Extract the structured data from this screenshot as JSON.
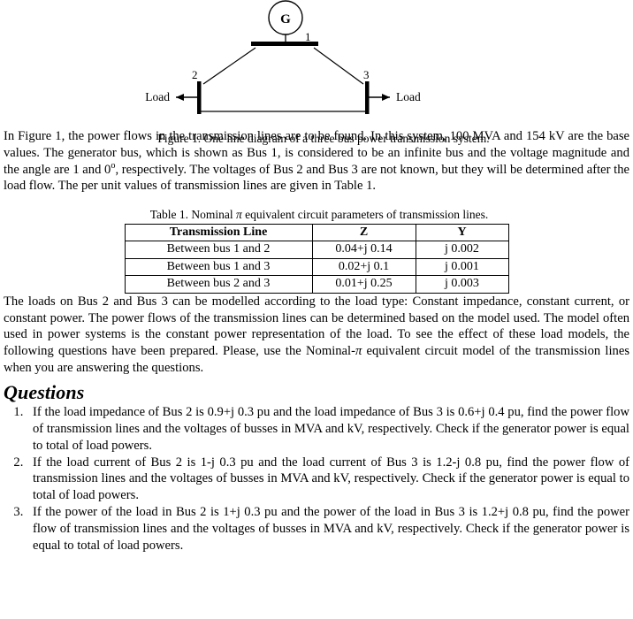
{
  "figure": {
    "generator_label": "G",
    "bus1_label": "1",
    "bus2_label": "2",
    "bus3_label": "3",
    "load_left_label": "Load",
    "load_right_label": "Load",
    "caption": "Figure 1. One line diagram of a three bus power transmission system."
  },
  "paragraphs": {
    "intro_part1": "In Figure 1, the power flows in the transmission lines are to be found. In this system, 100 MVA and 154 kV are the base values. The generator bus, which is shown as Bus 1, is considered to be an infinite bus and the voltage magnitude and the angle are 1 and 0",
    "intro_degree": "o",
    "intro_part2": ", respectively. The voltages of Bus 2 and Bus 3 are not known, but they will be determined after the load flow. The per unit values of transmission lines are given in Table 1.",
    "loads_part1": "The loads on Bus 2 and Bus 3 can be modelled according to the load type: Constant impedance, constant current, or constant power. The power flows of the transmission lines can be determined based on the model used. The model often used in power systems is the constant power representation of the load. To see the effect of these load models, the following questions have been prepared. Please, use the Nominal-",
    "loads_pi": "π",
    "loads_part2": " equivalent circuit model of the transmission lines when you are answering the questions."
  },
  "table": {
    "caption_part1": "Table 1. Nominal ",
    "caption_pi": "π",
    "caption_part2": " equivalent circuit parameters of transmission lines.",
    "headers": [
      "Transmission Line",
      "Z",
      "Y"
    ],
    "rows": [
      {
        "line": "Between bus 1 and 2",
        "z": "0.04+j 0.14",
        "y": "j 0.002"
      },
      {
        "line": "Between bus 1 and 3",
        "z": "0.02+j 0.1",
        "y": "j 0.001"
      },
      {
        "line": "Between bus 2 and 3",
        "z": "0.01+j 0.25",
        "y": "j 0.003"
      }
    ]
  },
  "questions": {
    "heading": "Questions",
    "items": [
      "If the load impedance of Bus 2 is 0.9+j 0.3 pu and the load impedance of Bus 3 is 0.6+j 0.4 pu, find the power flow of transmission lines and the voltages of busses in MVA and kV, respectively. Check if the generator power is equal to total of load powers.",
      "If the load current of Bus 2 is 1-j 0.3 pu and the load current of Bus 3 is 1.2-j 0.8 pu, find the power flow of transmission lines and the voltages of busses in MVA and kV, respectively. Check if the generator power is equal to total of load powers.",
      "If the power of the load in Bus 2 is 1+j 0.3 pu and the power of the load in Bus 3 is 1.2+j 0.8 pu, find the power flow of transmission lines and the voltages of busses in MVA and kV, respectively. Check if the generator power is equal to total of load powers."
    ]
  }
}
